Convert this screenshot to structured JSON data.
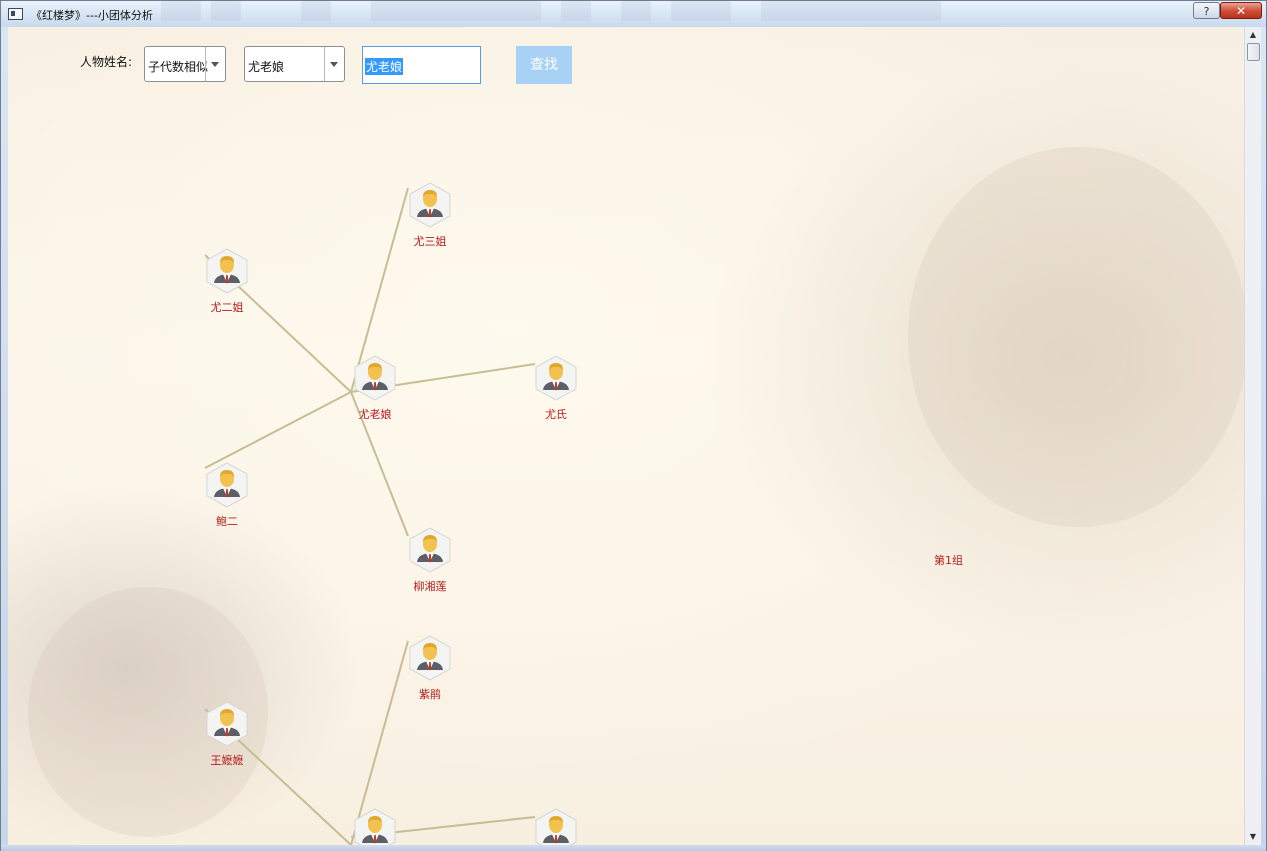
{
  "window": {
    "title": "《红楼梦》---小团体分析",
    "help_glyph": "?",
    "close_glyph": "✕"
  },
  "toolbar": {
    "name_label": "人物姓名:",
    "mode_select": "子代数相似",
    "person_select": "尤老娘",
    "search_value": "尤老娘",
    "find_button": "查找"
  },
  "graph": {
    "group_label": "第1组",
    "nodes": [
      {
        "name": "尤三姐"
      },
      {
        "name": "尤二姐"
      },
      {
        "name": "尤老娘"
      },
      {
        "name": "尤氏"
      },
      {
        "name": "鲍二"
      },
      {
        "name": "柳湘莲"
      },
      {
        "name": "紫鹃"
      },
      {
        "name": "王嬷嬷"
      }
    ],
    "edge_color": "#c8bd92",
    "label_color": "#b51c1c"
  },
  "scrollbar": {
    "up_glyph": "▲",
    "down_glyph": "▼"
  }
}
